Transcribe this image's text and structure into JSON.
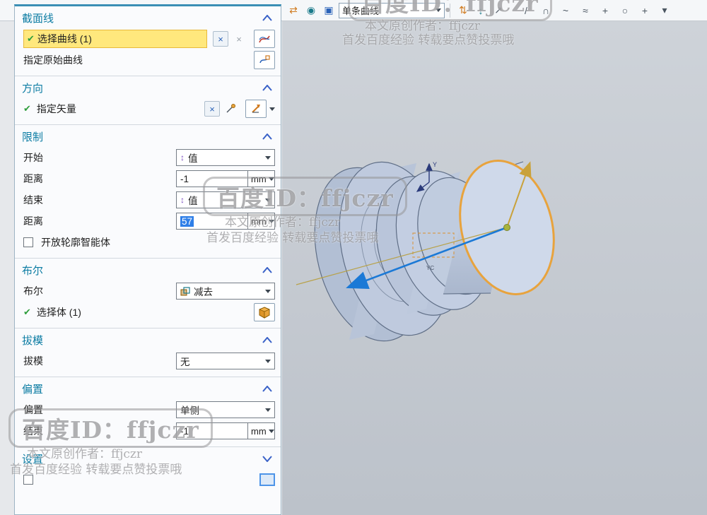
{
  "toolbar": {
    "curve_rule_value": "单条曲线",
    "left_icons": [
      {
        "name": "reverse-direction-icon",
        "glyph": "⇄"
      },
      {
        "name": "display-option-icon",
        "glyph": "◉"
      },
      {
        "name": "solid-body-icon",
        "glyph": "▣"
      }
    ],
    "mid_icons": [
      {
        "name": "swap-updown-icon",
        "glyph": "⇅"
      },
      {
        "name": "updown-icon",
        "glyph": "↕"
      },
      {
        "name": "direction-arrow-icon",
        "glyph": "↗"
      }
    ],
    "right_icons": [
      {
        "name": "line-icon",
        "glyph": "/"
      },
      {
        "name": "arc-icon",
        "glyph": "∩"
      },
      {
        "name": "spline-icon",
        "glyph": "~"
      },
      {
        "name": "studio-spline-icon",
        "glyph": "≈"
      },
      {
        "name": "point-icon",
        "glyph": "+"
      },
      {
        "name": "circle-icon",
        "glyph": "○"
      },
      {
        "name": "plus-icon",
        "glyph": "+"
      },
      {
        "name": "more-icon",
        "glyph": "▾"
      }
    ]
  },
  "panel": {
    "section_line": {
      "title": "截面线",
      "select_curve": "选择曲线 (1)",
      "original_curve": "指定原始曲线"
    },
    "direction": {
      "title": "方向",
      "specify_vector": "指定矢量"
    },
    "limits": {
      "title": "限制",
      "start_label": "开始",
      "start_option": "值",
      "distance_label1": "距离",
      "distance_value1": "-1",
      "end_label": "结束",
      "end_option": "值",
      "distance_label2": "距离",
      "distance_value2": "57",
      "unit": "mm",
      "open_profile_label": "开放轮廓智能体"
    },
    "boolean": {
      "title": "布尔",
      "label": "布尔",
      "value": "减去",
      "select_body": "选择体 (1)"
    },
    "draft": {
      "title": "拔模",
      "label": "拔模",
      "value": "无"
    },
    "offset": {
      "title": "偏置",
      "label": "偏置",
      "value": "单侧",
      "end_label": "结束",
      "end_value": "-1",
      "unit": "mm"
    },
    "settings": {
      "title": "设置"
    }
  },
  "icons": {
    "check_glyph": "✔",
    "cross_glyph": "×",
    "value_glyph": "↕"
  },
  "viewport": {
    "axis_y_label": "Y",
    "axis_yc_label": "YC"
  },
  "watermark": {
    "id_line": "百度ID：ffjczr",
    "author_line": "本文原创作者：ffjczr",
    "footer_line": "首发百度经验 转载要点赞投票哦"
  },
  "colors": {
    "highlight_row": "#ffe87d",
    "selection_blue": "#2f7fe8",
    "selected_edge_orange": "#e8a33d",
    "vector_blue": "#1b79d6",
    "header_teal": "#0c7ca3"
  }
}
